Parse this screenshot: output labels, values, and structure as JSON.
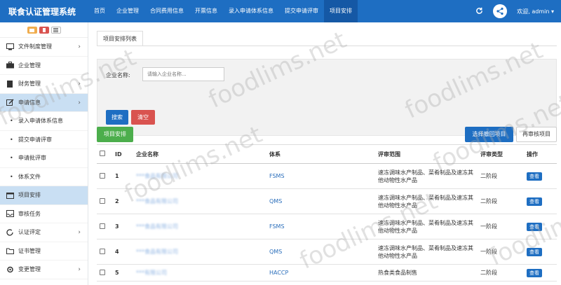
{
  "app_title": "联食认证管理系统",
  "nav": [
    "首页",
    "企业管理",
    "合同费用信息",
    "开票信息",
    "录入申请体系信息",
    "提交申请评审",
    "项目安排"
  ],
  "user": {
    "label": "欢迎, admin"
  },
  "sidebar": {
    "items": [
      {
        "label": "文件制度管理",
        "icon": "monitor-icon",
        "chevron": "›"
      },
      {
        "label": "企业管理",
        "icon": "briefcase-icon",
        "chevron": ""
      },
      {
        "label": "财务管理",
        "icon": "document-icon",
        "chevron": "›"
      },
      {
        "label": "申请信息",
        "icon": "edit-icon",
        "chevron": "›"
      },
      {
        "label": "录入申请体系信息",
        "icon": "",
        "chevron": ""
      },
      {
        "label": "提交申请评审",
        "icon": "",
        "chevron": ""
      },
      {
        "label": "申请批评审",
        "icon": "",
        "chevron": ""
      },
      {
        "label": "体系文件",
        "icon": "",
        "chevron": ""
      },
      {
        "label": "项目安排",
        "icon": "calendar-icon",
        "chevron": ""
      },
      {
        "label": "审核任务",
        "icon": "inbox-icon",
        "chevron": ""
      },
      {
        "label": "认证评定",
        "icon": "refresh-icon",
        "chevron": "›"
      },
      {
        "label": "证书管理",
        "icon": "folder-icon",
        "chevron": ""
      },
      {
        "label": "变更管理",
        "icon": "cog-icon",
        "chevron": "›"
      }
    ]
  },
  "tab": {
    "label": "项目安排列表"
  },
  "search": {
    "label": "企业名称:",
    "placeholder": "请输入企业名称...",
    "search_btn": "搜索",
    "clear_btn": "清空"
  },
  "actions": {
    "arrange": "项目安排",
    "select_return": "选择撤回项目",
    "reaudit": "再审核项目"
  },
  "table": {
    "headers": [
      "ID",
      "企业名称",
      "体系",
      "评审范围",
      "评审类型",
      "操作"
    ],
    "rows": [
      {
        "id": "1",
        "company": "***食品有限公司",
        "system": "FSMS",
        "scope": "速冻调味水产制品、菜肴制品及速冻其他动物性水产品",
        "type": "二阶段",
        "action": "查看"
      },
      {
        "id": "2",
        "company": "***食品有限公司",
        "system": "QMS",
        "scope": "速冻调味水产制品、菜肴制品及速冻其他动物性水产品",
        "type": "二阶段",
        "action": "查看"
      },
      {
        "id": "3",
        "company": "***食品有限公司",
        "system": "FSMS",
        "scope": "速冻调味水产制品、菜肴制品及速冻其他动物性水产品",
        "type": "一阶段",
        "action": "查看"
      },
      {
        "id": "4",
        "company": "***食品有限公司",
        "system": "QMS",
        "scope": "速冻调味水产制品、菜肴制品及速冻其他动物性水产品",
        "type": "一阶段",
        "action": "查看"
      },
      {
        "id": "5",
        "company": "***有限公司",
        "system": "HACCP",
        "scope": "热食类食品制售",
        "type": "二阶段",
        "action": "查看"
      }
    ]
  },
  "watermark": "foodlims.net"
}
